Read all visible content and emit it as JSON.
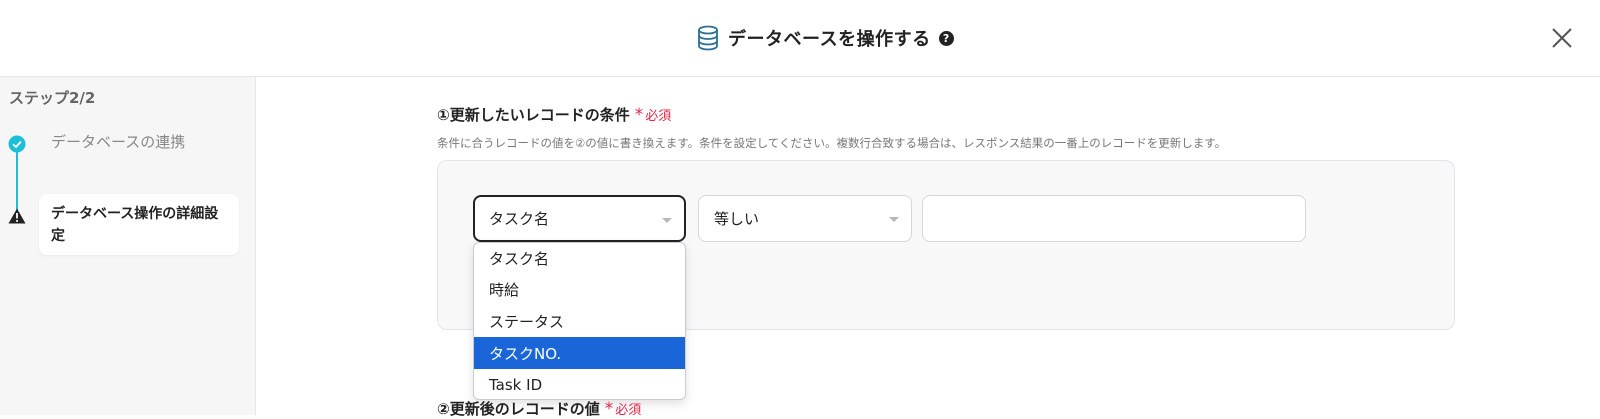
{
  "header": {
    "title": "データベースを操作する",
    "help_icon": "?",
    "icon": "database-icon",
    "close_icon": "close-icon"
  },
  "sidebar": {
    "step_count": "ステップ2/2",
    "steps": [
      {
        "label": "データベースの連携",
        "status": "completed",
        "icon": "check-circle-icon"
      },
      {
        "label": "データベース操作の詳細設定",
        "status": "warning",
        "icon": "warning-icon"
      }
    ]
  },
  "section1": {
    "title": "①更新したいレコードの条件",
    "required_star": "*",
    "required_label": "必須",
    "description": "条件に合うレコードの値を②の値に書き換えます。条件を設定してください。複数行合致する場合は、レスポンス結果の一番上のレコードを更新します。",
    "field_select": "タスク名",
    "operator_select": "等しい",
    "value_input": ""
  },
  "dropdown": {
    "options": [
      "タスク名",
      "時給",
      "ステータス",
      "タスクNO.",
      "Task ID"
    ],
    "highlighted": "タスクNO."
  },
  "section2": {
    "title": "②更新後のレコードの値",
    "required_star": "*",
    "required_label": "必須"
  },
  "colors": {
    "accent": "#1a66d9",
    "step_line": "#1bbfd8",
    "required": "#e0284a"
  }
}
